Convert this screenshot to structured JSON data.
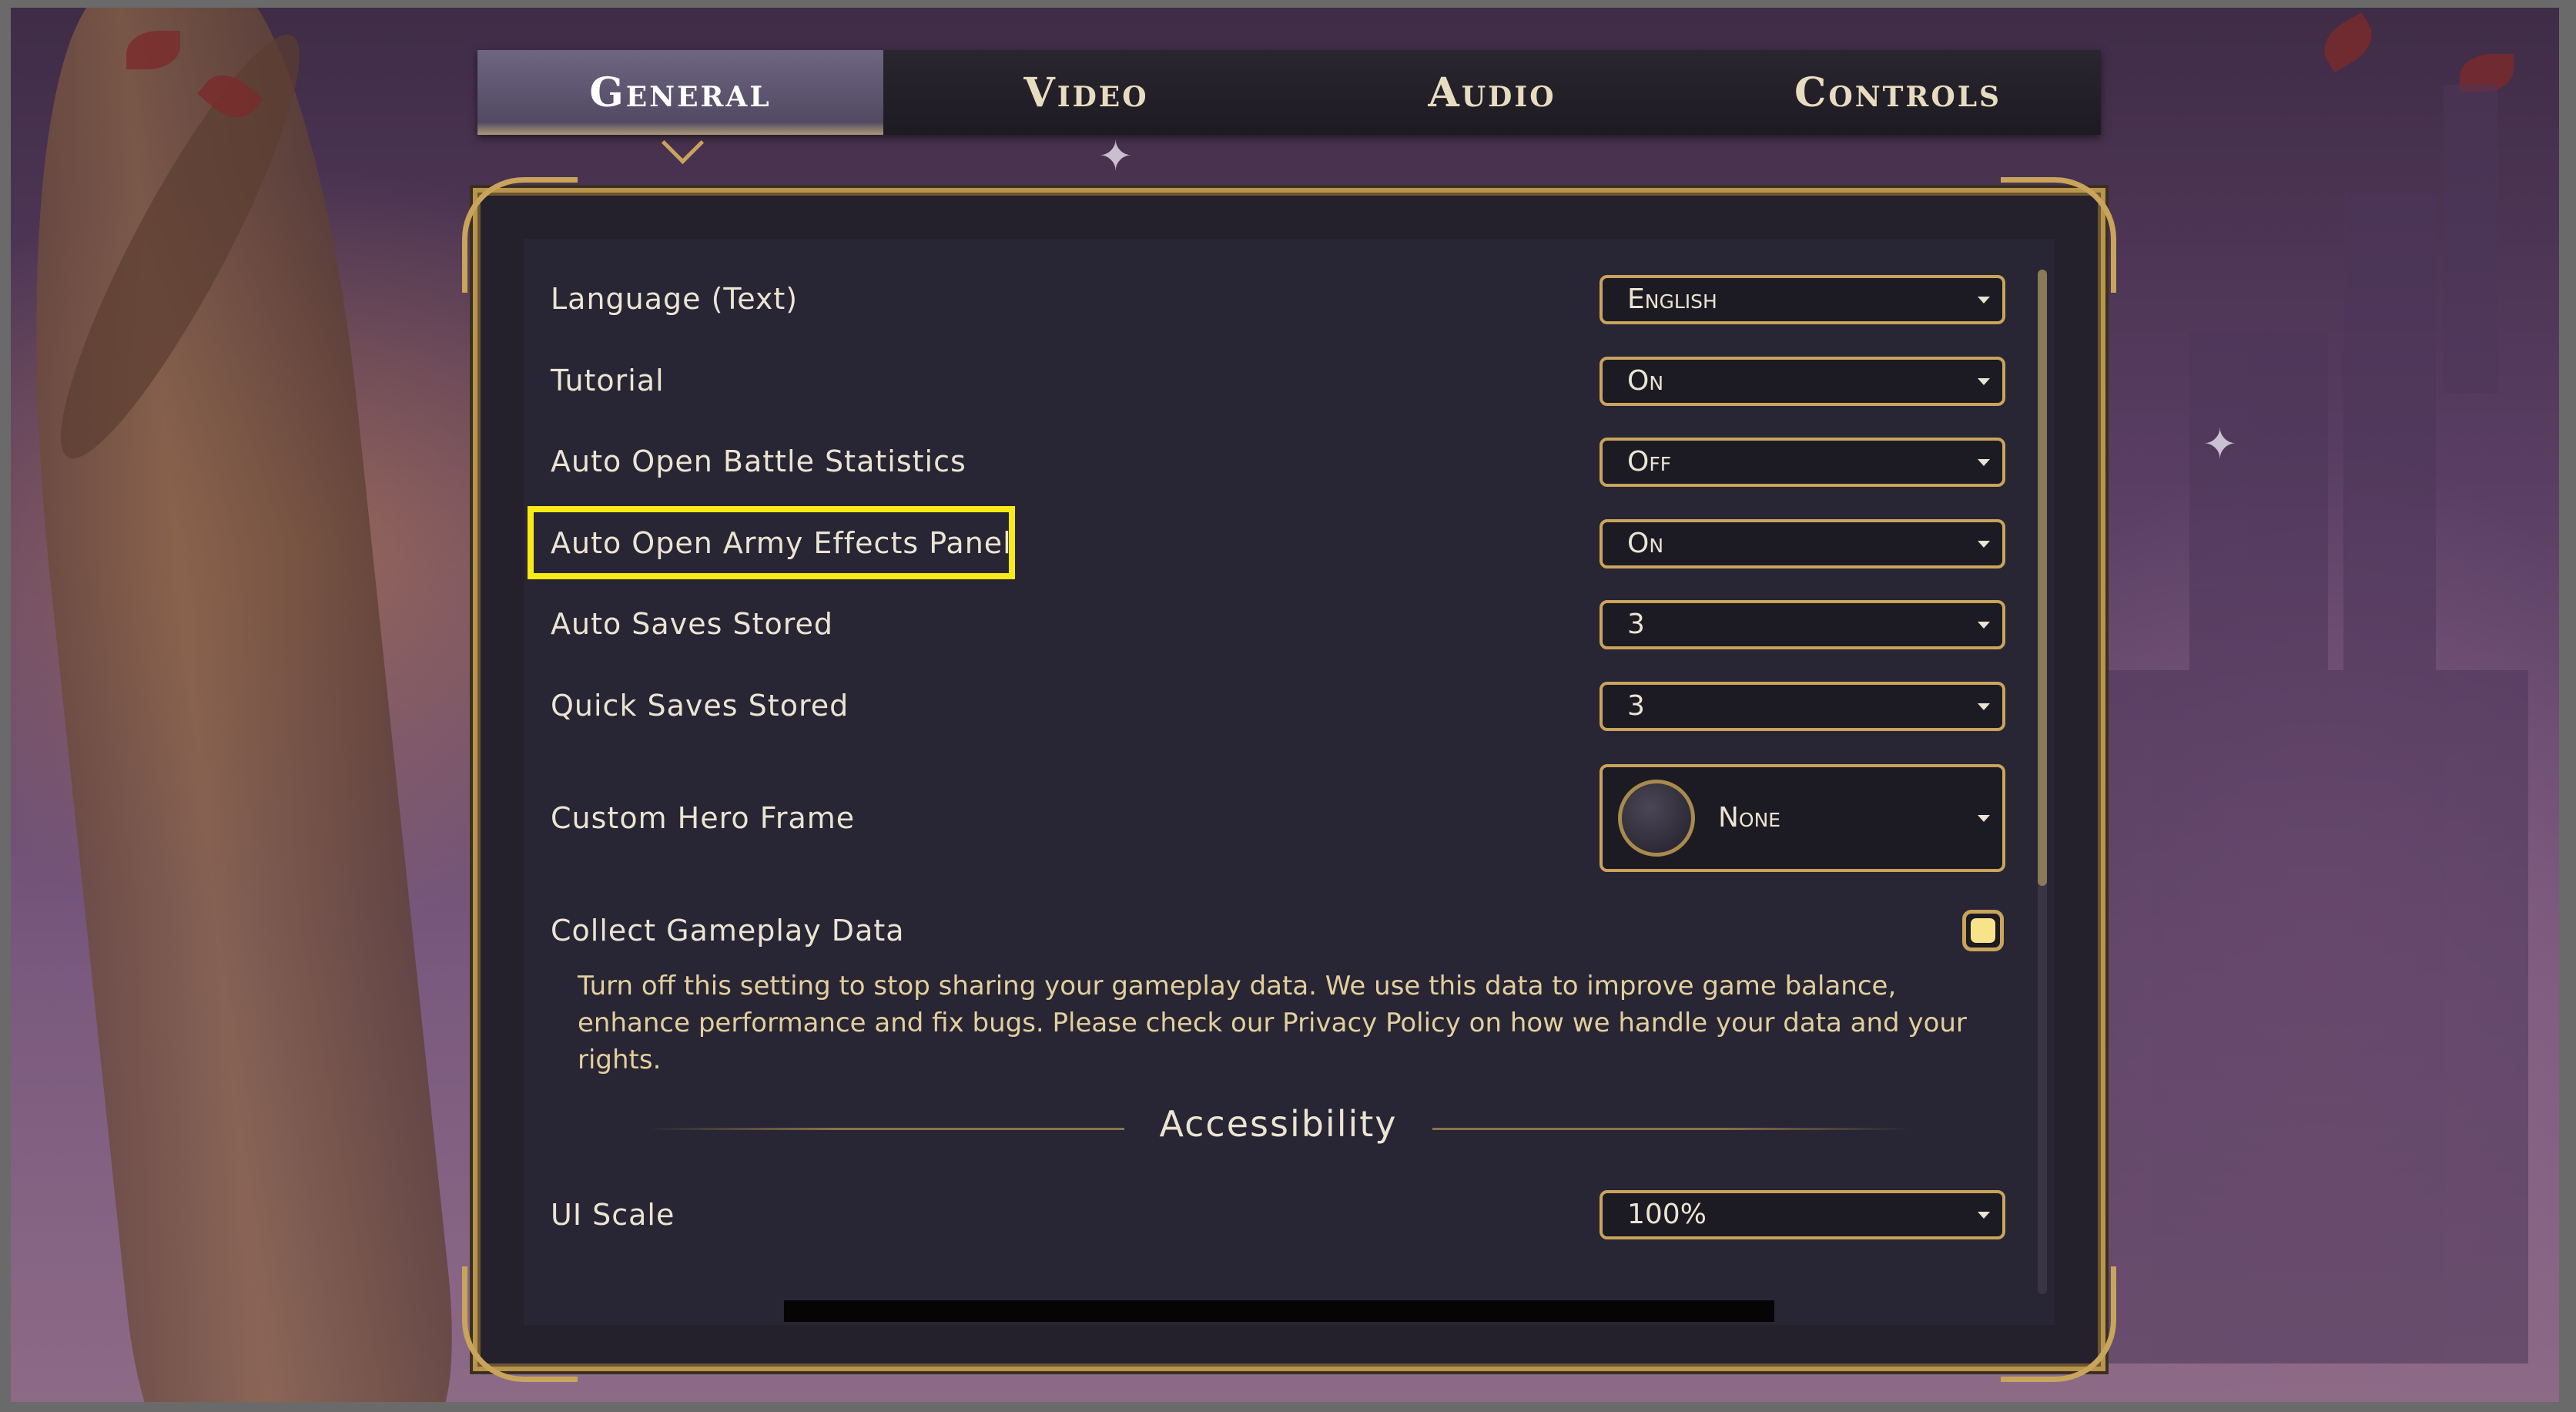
{
  "tabs": [
    {
      "label": "General",
      "active": true
    },
    {
      "label": "Video",
      "active": false
    },
    {
      "label": "Audio",
      "active": false
    },
    {
      "label": "Controls",
      "active": false
    }
  ],
  "settings": {
    "language": {
      "label": "Language (Text)",
      "value": "English"
    },
    "tutorial": {
      "label": "Tutorial",
      "value": "On"
    },
    "auto_battle_stats": {
      "label": "Auto Open Battle Statistics",
      "value": "Off"
    },
    "auto_army_effects": {
      "label": "Auto Open Army Effects Panel",
      "value": "On",
      "highlighted": true
    },
    "auto_saves": {
      "label": "Auto Saves Stored",
      "value": "3"
    },
    "quick_saves": {
      "label": "Quick Saves Stored",
      "value": "3"
    },
    "hero_frame": {
      "label": "Custom Hero Frame",
      "value": "None"
    },
    "gameplay_data": {
      "label": "Collect Gameplay Data",
      "checked": true,
      "description": "Turn off this setting to stop sharing your gameplay data. We use this data to improve game balance, enhance performance and fix bugs. Please check our Privacy Policy on how we handle your data and your rights."
    },
    "accessibility_heading": "Accessibility",
    "ui_scale": {
      "label": "UI Scale",
      "value": "100%"
    }
  },
  "colors": {
    "accent_gold": "#c9a45b",
    "highlight_yellow": "#f7ea16",
    "panel_bg": "#282534",
    "text_light": "#ece4d2",
    "checkbox_fill": "#f7e38a"
  },
  "icons": {
    "dropdown": "chevron-down-icon",
    "sparkle": "sparkle-icon"
  }
}
